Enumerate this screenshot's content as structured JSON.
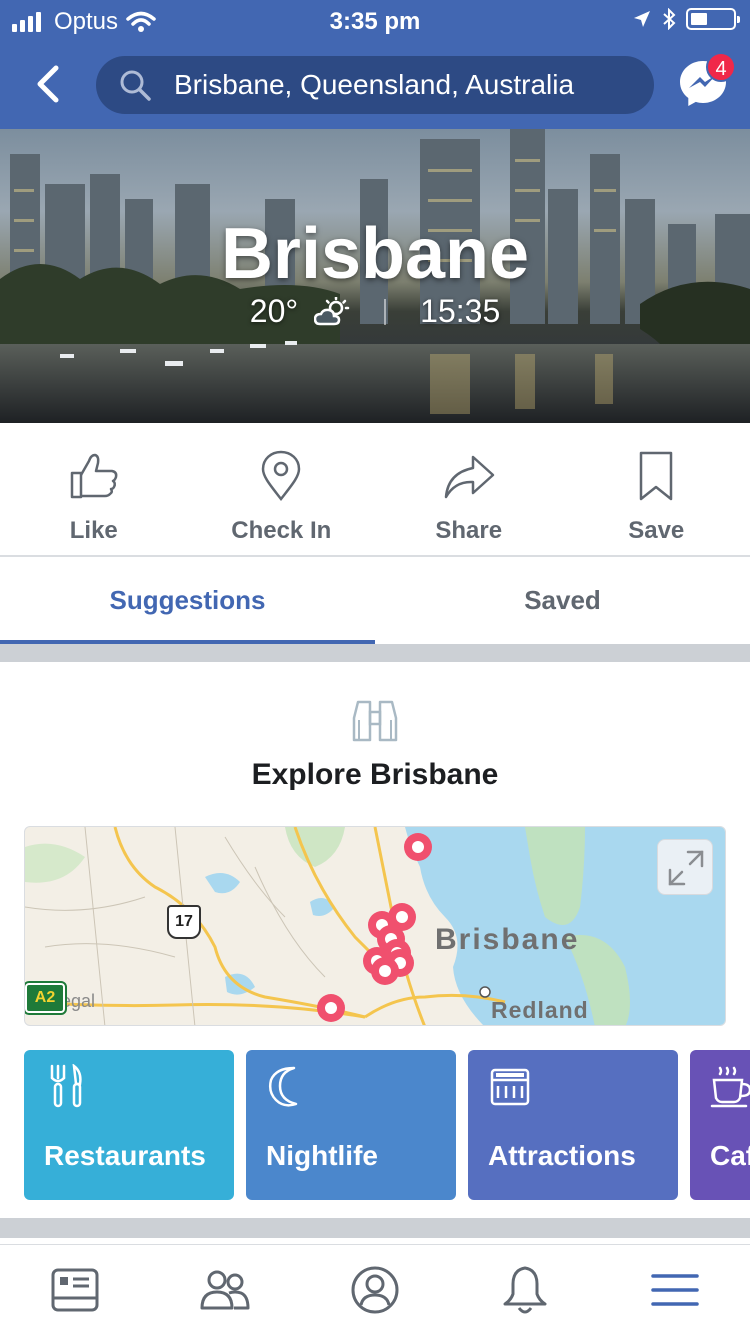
{
  "status_bar": {
    "carrier": "Optus",
    "time": "3:35 pm"
  },
  "header": {
    "search_text": "Brisbane, Queensland, Australia",
    "messenger_badge": "4",
    "colors": {
      "brand": "#4267b2",
      "search_bg": "#2d4a84",
      "badge": "#f02849"
    }
  },
  "hero": {
    "title": "Brisbane",
    "temperature": "20°",
    "weather_icon": "partly-cloudy-icon",
    "local_time": "15:35"
  },
  "actions": [
    {
      "label": "Like",
      "icon": "thumbs-up-icon"
    },
    {
      "label": "Check In",
      "icon": "location-pin-icon"
    },
    {
      "label": "Share",
      "icon": "share-arrow-icon"
    },
    {
      "label": "Save",
      "icon": "bookmark-icon"
    }
  ],
  "tabs": {
    "items": [
      {
        "label": "Suggestions",
        "active": true
      },
      {
        "label": "Saved",
        "active": false
      }
    ]
  },
  "explore": {
    "icon": "binoculars-icon",
    "title": "Explore Brisbane"
  },
  "map": {
    "city_label": "Brisbane",
    "redland_label": "Redland",
    "legal_label": "Legal",
    "route_shield": "17",
    "route_a2": "A2",
    "expand_icon": "expand-icon"
  },
  "categories": [
    {
      "label": "Restaurants",
      "icon": "fork-knife-icon",
      "color": "#36afd8"
    },
    {
      "label": "Nightlife",
      "icon": "moon-icon",
      "color": "#4b87cc"
    },
    {
      "label": "Attractions",
      "icon": "landmark-icon",
      "color": "#566fc0"
    },
    {
      "label": "Cafés",
      "icon": "coffee-cup-icon",
      "color": "#6852b6"
    }
  ],
  "bottom_nav": [
    {
      "icon": "news-feed-icon",
      "active": false
    },
    {
      "icon": "friends-icon",
      "active": false
    },
    {
      "icon": "profile-icon",
      "active": false
    },
    {
      "icon": "notifications-bell-icon",
      "active": false
    },
    {
      "icon": "menu-icon",
      "active": true
    }
  ]
}
